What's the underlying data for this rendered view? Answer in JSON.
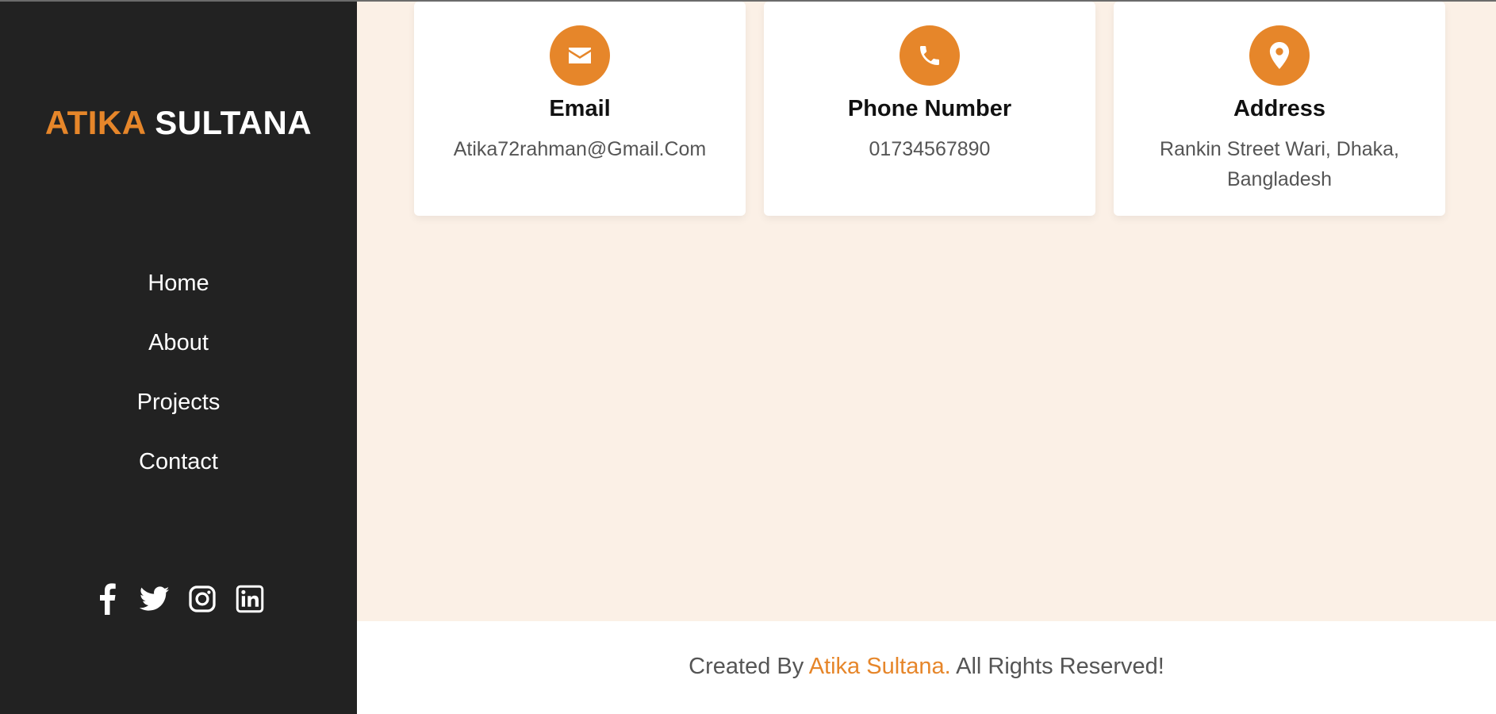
{
  "brand": {
    "first_name": "ATIKA",
    "last_name": "SULTANA",
    "accent_color": "#e6862a"
  },
  "sidebar": {
    "background": "#222222",
    "nav": [
      {
        "label": "Home"
      },
      {
        "label": "About"
      },
      {
        "label": "Projects"
      },
      {
        "label": "Contact"
      }
    ],
    "social": [
      {
        "icon": "facebook-icon"
      },
      {
        "icon": "twitter-icon"
      },
      {
        "icon": "instagram-icon"
      },
      {
        "icon": "linkedin-icon"
      }
    ]
  },
  "contact_cards": [
    {
      "icon": "envelope-icon",
      "title": "Email",
      "value": "Atika72rahman@Gmail.Com"
    },
    {
      "icon": "phone-icon",
      "title": "Phone Number",
      "value": "01734567890"
    },
    {
      "icon": "map-pin-icon",
      "title": "Address",
      "value": "Rankin Street Wari, Dhaka, Bangladesh"
    }
  ],
  "footer": {
    "prefix": "Created By ",
    "author": "Atika Sultana.",
    "suffix": " All Rights Reserved!"
  },
  "colors": {
    "main_background": "#fbf0e6",
    "card_background": "#ffffff"
  }
}
